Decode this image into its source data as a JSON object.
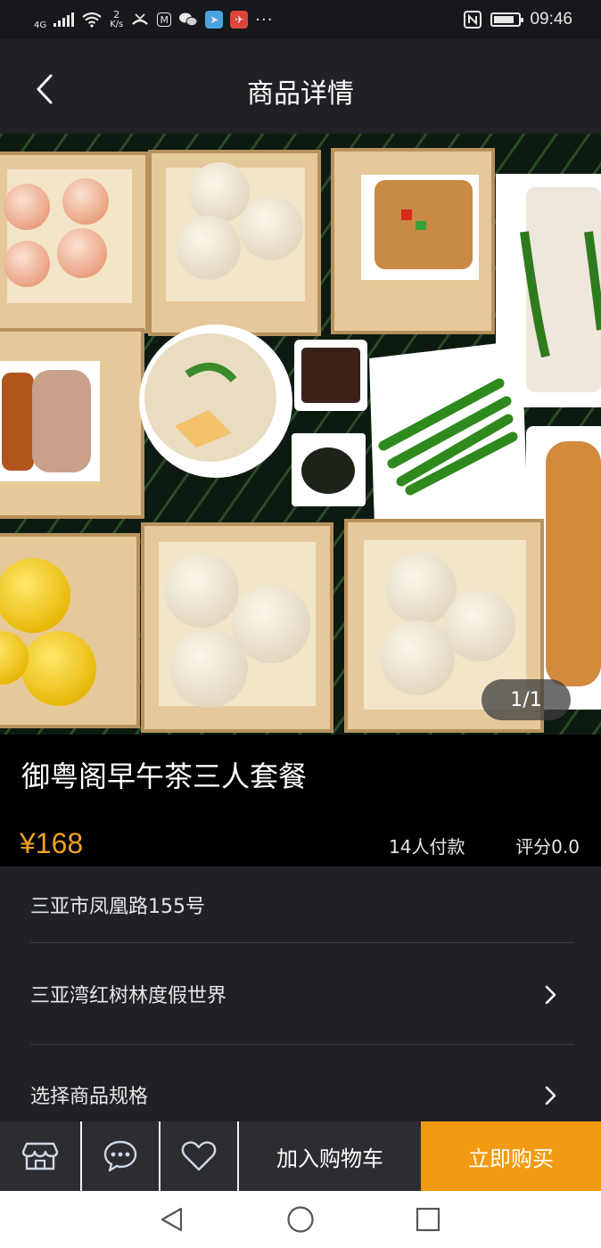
{
  "status_bar": {
    "network": "4G",
    "speed_value": "2",
    "speed_unit": "K/s",
    "more": "···",
    "time": "09:46",
    "battery_level": 0.85,
    "icons": [
      "signal-icon",
      "wifi-icon",
      "missed-call-icon",
      "mail-icon",
      "wechat-icon",
      "app-icon",
      "app-icon",
      "nfc-icon",
      "battery-icon"
    ]
  },
  "header": {
    "title": "商品详情",
    "back_icon": "chevron-left-icon"
  },
  "gallery": {
    "counter": "1/1"
  },
  "product": {
    "title": "御粤阁早午茶三人套餐",
    "price": "¥168",
    "buyers": "14人付款",
    "rating": "评分0.0"
  },
  "details": {
    "address": "三亚市凤凰路155号",
    "venue": "三亚湾红树林度假世界",
    "spec": "选择商品规格"
  },
  "actions": {
    "shop_icon": "shop-icon",
    "chat_icon": "chat-icon",
    "fav_icon": "heart-icon",
    "add_to_cart": "加入购物车",
    "buy_now": "立即购买"
  },
  "colors": {
    "accent": "#f39a13",
    "price": "#f0a020",
    "background": "#1f2125"
  }
}
